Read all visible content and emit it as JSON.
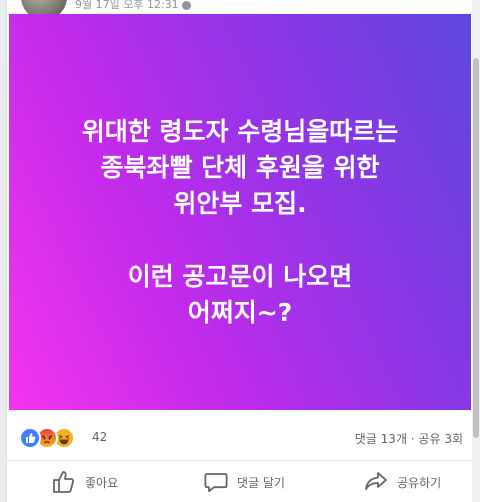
{
  "post": {
    "timestamp": "9월 17일 오후 12:31",
    "banner_lines": [
      "위대한 령도자 수령님을따르는",
      "종북좌빨 단체 후원을 위한",
      "위안부 모집.",
      "",
      "이런 공고문이 나오면",
      "어쩌지~?"
    ],
    "banner_colors": {
      "start": "#f434ef",
      "end": "#5e47de"
    }
  },
  "reactions": {
    "icons": [
      "like-icon",
      "angry-icon",
      "haha-icon"
    ],
    "count": "42",
    "comments_shares": "댓글 13개 · 공유 3회"
  },
  "actions": {
    "like": "좋아요",
    "comment": "댓글 달기",
    "share": "공유하기"
  }
}
